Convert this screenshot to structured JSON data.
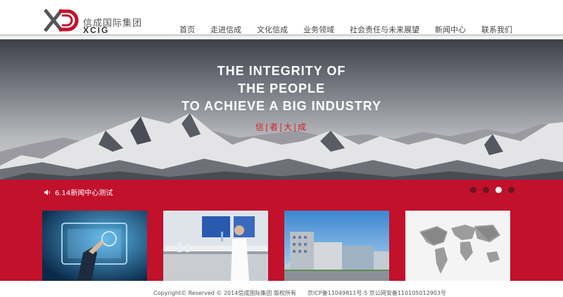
{
  "brand": {
    "name_cn": "信成国际集团",
    "name_en": "XCIG",
    "accent_red": "#c1112b",
    "logo_icon": "xd-logo-icon"
  },
  "nav": {
    "items": [
      "首页",
      "走进信成",
      "文化信成",
      "业务领域",
      "社会责任与未来展望",
      "新闻中心",
      "联系我们"
    ]
  },
  "hero": {
    "line1": "THE INTEGRITY OF",
    "line2": "THE PEOPLE",
    "line3": "TO ACHIEVE A BIG INDUSTRY",
    "motto": "信|者|大|成"
  },
  "news": {
    "icon": "speaker-icon",
    "headline": "6.14新闻中心测试"
  },
  "slider": {
    "dot_count": 4,
    "active_index": 2
  },
  "thumbnails": [
    {
      "name": "thumb-digital-touchscreen",
      "subject": "business-tech"
    },
    {
      "name": "thumb-laboratory",
      "subject": "lab-scientist"
    },
    {
      "name": "thumb-buildings",
      "subject": "office-buildings"
    },
    {
      "name": "thumb-world-map",
      "subject": "world-map"
    }
  ],
  "footer": {
    "text": "Copyright© Reserved © 2014信成国际集团 版权所有　　京ICP备11049811号-5 京公网安备110105012903号"
  }
}
